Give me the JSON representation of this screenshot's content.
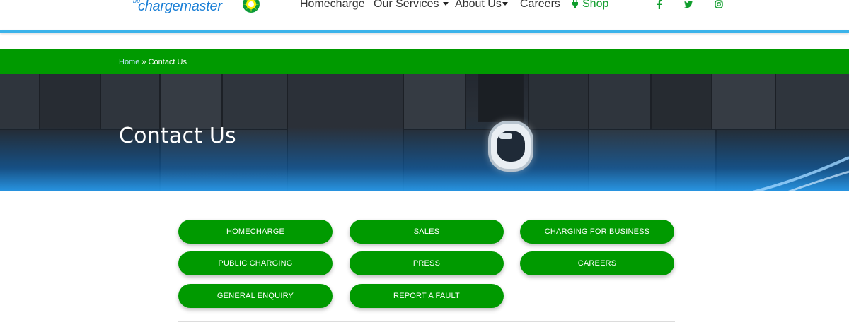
{
  "brand": {
    "logo_prefix": "bp",
    "logo_text_1": "charge",
    "logo_text_2": "master"
  },
  "nav": {
    "items": [
      {
        "label": "Homecharge",
        "dropdown": false
      },
      {
        "label": "Our Services",
        "dropdown": true
      },
      {
        "label": "About Us",
        "dropdown": true
      },
      {
        "label": "Careers",
        "dropdown": false
      },
      {
        "label": "Shop",
        "dropdown": false
      }
    ],
    "social": [
      "facebook-icon",
      "twitter-icon",
      "instagram-icon"
    ]
  },
  "breadcrumb": {
    "home": "Home",
    "separator": " » ",
    "current": "Contact Us"
  },
  "hero": {
    "title": "Contact Us"
  },
  "buttons": [
    "HOMECHARGE",
    "SALES",
    "CHARGING FOR BUSINESS",
    "PUBLIC CHARGING",
    "PRESS",
    "CAREERS",
    "GENERAL ENQUIRY",
    "REPORT A FAULT"
  ],
  "colors": {
    "primary_green": "#009a00",
    "accent_blue": "#3bb3ea",
    "shop_green": "#0f9d2c"
  }
}
